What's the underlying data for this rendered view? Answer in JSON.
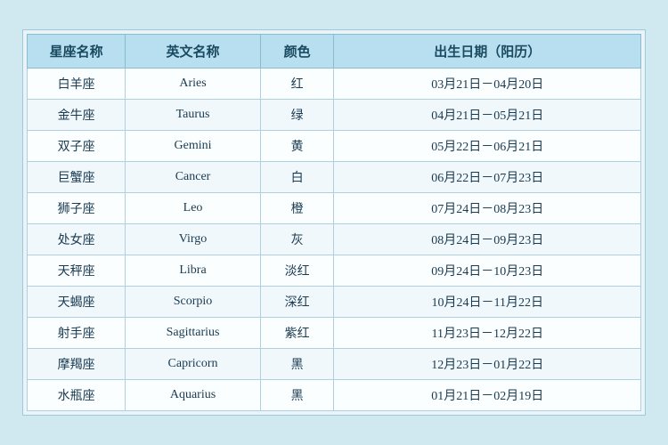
{
  "table": {
    "headers": {
      "chinese_name": "星座名称",
      "english_name": "英文名称",
      "color": "颜色",
      "birth_date": "出生日期（阳历）"
    },
    "rows": [
      {
        "chinese": "白羊座",
        "english": "Aries",
        "color": "红",
        "dates": "03月21日－04月20日"
      },
      {
        "chinese": "金牛座",
        "english": "Taurus",
        "color": "绿",
        "dates": "04月21日－05月21日"
      },
      {
        "chinese": "双子座",
        "english": "Gemini",
        "color": "黄",
        "dates": "05月22日－06月21日"
      },
      {
        "chinese": "巨蟹座",
        "english": "Cancer",
        "color": "白",
        "dates": "06月22日－07月23日"
      },
      {
        "chinese": "狮子座",
        "english": "Leo",
        "color": "橙",
        "dates": "07月24日－08月23日"
      },
      {
        "chinese": "处女座",
        "english": "Virgo",
        "color": "灰",
        "dates": "08月24日－09月23日"
      },
      {
        "chinese": "天秤座",
        "english": "Libra",
        "color": "淡红",
        "dates": "09月24日－10月23日"
      },
      {
        "chinese": "天蝎座",
        "english": "Scorpio",
        "color": "深红",
        "dates": "10月24日－11月22日"
      },
      {
        "chinese": "射手座",
        "english": "Sagittarius",
        "color": "紫红",
        "dates": "11月23日－12月22日"
      },
      {
        "chinese": "摩羯座",
        "english": "Capricorn",
        "color": "黑",
        "dates": "12月23日－01月22日"
      },
      {
        "chinese": "水瓶座",
        "english": "Aquarius",
        "color": "黑",
        "dates": "01月21日－02月19日"
      }
    ]
  }
}
